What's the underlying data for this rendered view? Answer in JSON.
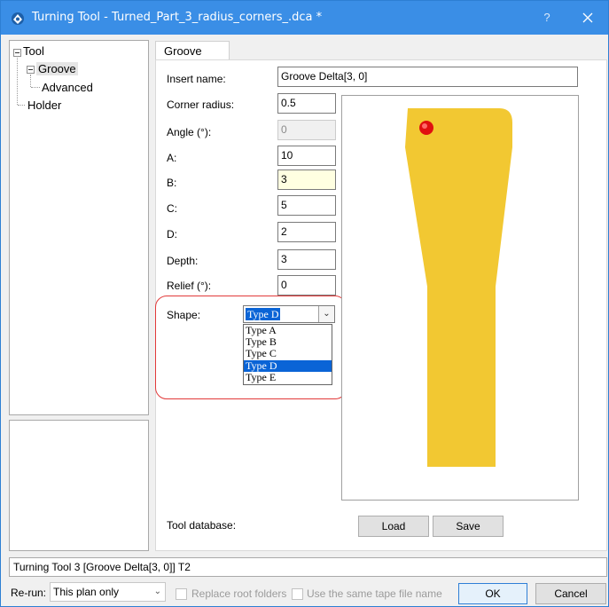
{
  "window": {
    "title": "Turning Tool - Turned_Part_3_radius_corners_.dca *",
    "help_label": "?",
    "title_bar_color": "#3a8ee6"
  },
  "tree": {
    "root": "Tool",
    "items": [
      {
        "label": "Groove",
        "selected": true
      },
      {
        "label": "Advanced"
      },
      {
        "label": "Holder"
      }
    ]
  },
  "tab": {
    "label": "Groove"
  },
  "form": {
    "insert_name": {
      "label": "Insert name:",
      "value": "Groove Delta[3, 0]"
    },
    "corner_radius": {
      "label": "Corner radius:",
      "value": "0.5"
    },
    "angle": {
      "label": "Angle (°):",
      "value": "0",
      "disabled": true
    },
    "a": {
      "label": "A:",
      "value": "10"
    },
    "b": {
      "label": "B:",
      "value": "3"
    },
    "c": {
      "label": "C:",
      "value": "5"
    },
    "d": {
      "label": "D:",
      "value": "2"
    },
    "depth": {
      "label": "Depth:",
      "value": "3"
    },
    "relief": {
      "label": "Relief (°):",
      "value": "0"
    },
    "shape": {
      "label": "Shape:",
      "value": "Type D",
      "options": [
        "Type A",
        "Type B",
        "Type C",
        "Type D",
        "Type E"
      ],
      "selected_index": 3
    },
    "tool_database": {
      "label": "Tool database:"
    },
    "load_button": "Load",
    "save_button": "Save"
  },
  "preview": {
    "tool_color": "#f2c832",
    "marker_color": "#e01010"
  },
  "status": {
    "text": "Turning Tool 3 [Groove Delta[3, 0]] T2"
  },
  "footer": {
    "rerun_label": "Re-run:",
    "rerun_value": "This plan only",
    "replace_root_label": "Replace root folders",
    "same_tape_label": "Use the same tape file name",
    "ok_button": "OK",
    "cancel_button": "Cancel"
  },
  "annotation_color": "#e23a3a"
}
